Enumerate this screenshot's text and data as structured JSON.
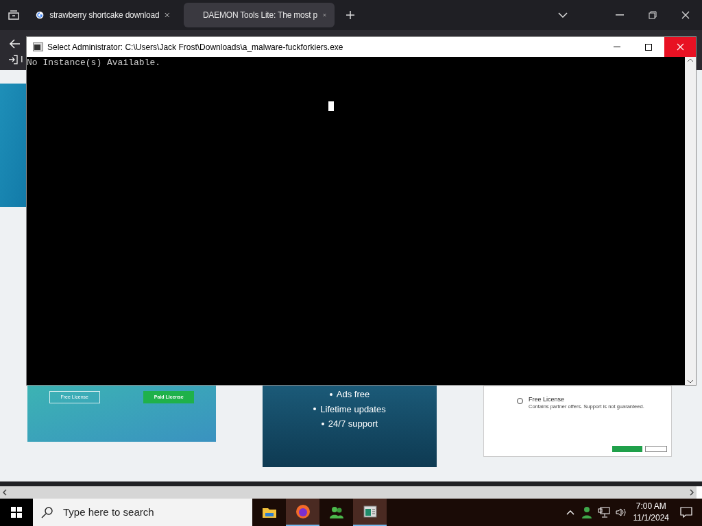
{
  "browser": {
    "tabs": [
      {
        "title": "strawberry shortcake download",
        "selected": false,
        "favicon": true
      },
      {
        "title": "DAEMON Tools Lite: The most p",
        "selected": true,
        "favicon": false
      }
    ],
    "bookmark": "I"
  },
  "page": {
    "left_banner": {
      "buttons": [
        {
          "label": "Free License",
          "kind": "outline"
        },
        {
          "label": "Paid License",
          "kind": "solid"
        }
      ]
    },
    "features": [
      "Ads free",
      "Lifetime updates",
      "24/7 support"
    ],
    "installer": {
      "option": "Free License",
      "note": "Contains partner offers. Support is not guaranteed.",
      "selected": false
    }
  },
  "console": {
    "title": "Select Administrator: C:\\Users\\Jack Frost\\Downloads\\a_malware-fuckforkiers.exe",
    "lines": [
      "No Instance(s) Available."
    ]
  },
  "taskbar": {
    "search_placeholder": "Type here to search",
    "apps": [
      {
        "kind": "folder",
        "active": false
      },
      {
        "kind": "firefox",
        "active": true
      },
      {
        "kind": "people",
        "active": false
      },
      {
        "kind": "console",
        "active": true
      }
    ],
    "time": "7:00 AM",
    "date": "11/1/2024"
  }
}
